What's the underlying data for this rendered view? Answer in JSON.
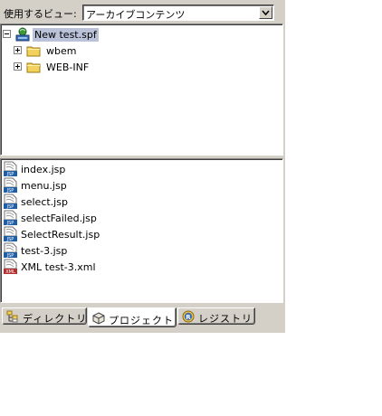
{
  "view_selector": {
    "label": "使用するビュー:",
    "selected": "アーカイブコンテンツ"
  },
  "tree": {
    "root": {
      "label": "New test.spf",
      "icon": "project-icon",
      "selected": true
    },
    "children": [
      {
        "label": "wbem",
        "icon": "folder-icon"
      },
      {
        "label": "WEB-INF",
        "icon": "folder-icon"
      }
    ]
  },
  "files": [
    {
      "label": "index.jsp",
      "type": "JSP"
    },
    {
      "label": "menu.jsp",
      "type": "JSP"
    },
    {
      "label": "select.jsp",
      "type": "JSP"
    },
    {
      "label": "selectFailed.jsp",
      "type": "JSP"
    },
    {
      "label": "SelectResult.jsp",
      "type": "JSP"
    },
    {
      "label": "test-3.jsp",
      "type": "JSP"
    },
    {
      "label": "XML test-3.xml",
      "type": "XML"
    }
  ],
  "tabs": [
    {
      "label": "ディレクトリ",
      "icon": "directory-icon",
      "active": false
    },
    {
      "label": "プロジェクト",
      "icon": "project-box-icon",
      "active": true
    },
    {
      "label": "レジストリ",
      "icon": "registry-icon",
      "active": false
    }
  ],
  "colors": {
    "panel_bg": "#d4d0c8",
    "selection_bg": "#b9c2d8",
    "jsp_badge": "#1f5fa8",
    "xml_badge": "#b03030"
  }
}
